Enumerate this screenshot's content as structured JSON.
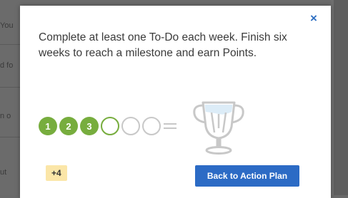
{
  "background": {
    "snippets": [
      "You",
      "d fo",
      "n o",
      "ut"
    ]
  },
  "modal": {
    "close_icon": "×",
    "message": "Complete at least one To-Do each week. Finish six weeks to reach a milestone and earn Points.",
    "progress": {
      "completed_weeks": [
        "1",
        "2",
        "3"
      ],
      "total_weeks": 6,
      "icon": "trophy-icon"
    },
    "points_badge": "+4",
    "action_button": "Back to Action Plan"
  },
  "colors": {
    "accent_green": "#77ad3e",
    "button_blue": "#2c6bc5",
    "close_blue": "#2e6fc2",
    "badge_yellow": "#fbe6a8",
    "inactive_gray": "#c8c8c8"
  }
}
